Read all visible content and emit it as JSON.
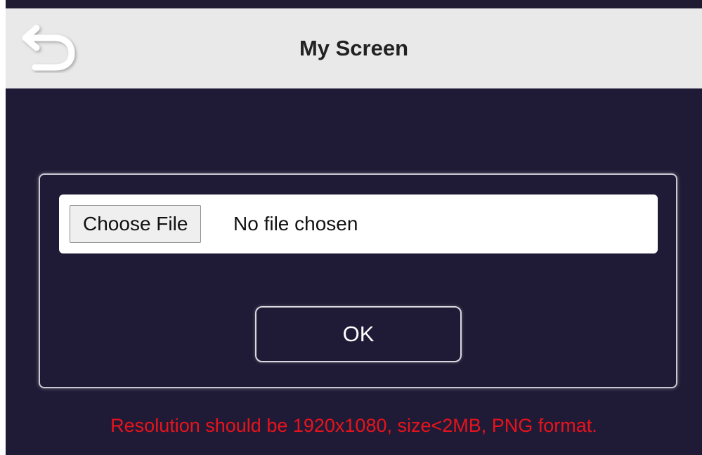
{
  "header": {
    "title": "My Screen",
    "back_icon": "back-arrow-icon"
  },
  "upload": {
    "choose_label": "Choose File",
    "status_text": "No file chosen"
  },
  "actions": {
    "ok_label": "OK"
  },
  "hint": {
    "text": "Resolution should be 1920x1080, size<2MB, PNG format."
  },
  "colors": {
    "header_bg": "#e9e9e9",
    "body_bg": "#1f1b36",
    "hint_color": "#e8131c",
    "text_light": "#ffffff"
  }
}
